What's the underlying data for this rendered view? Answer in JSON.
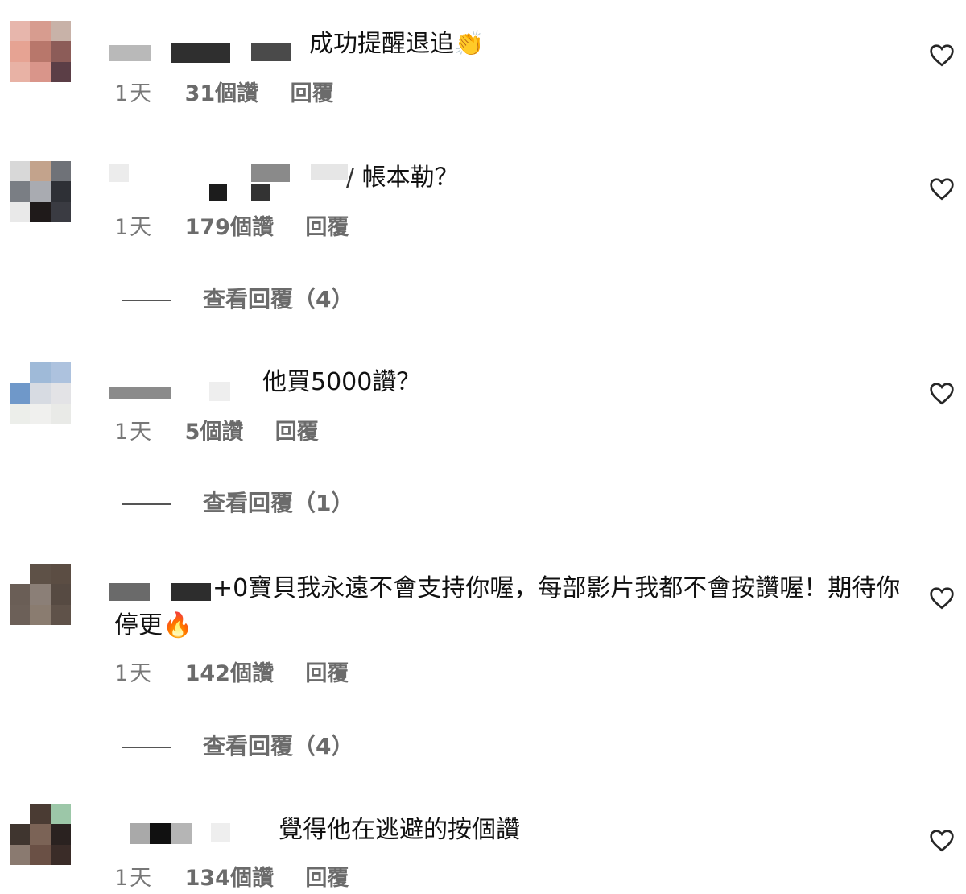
{
  "comments": [
    {
      "text": "成功提醒退追",
      "emoji": "👏",
      "time": "1天",
      "likes": "31個讚",
      "reply": "回覆",
      "view_replies": null,
      "avatar_colors": [
        "#e7b6ac",
        "#d79c8f",
        "#c8b2a8",
        "#e6a393",
        "#b8776b",
        "#8c5c58",
        "#e8b2a5",
        "#d9958a",
        "#5b3e46"
      ]
    },
    {
      "text": "帳本勒？",
      "emoji": "",
      "time": "1天",
      "likes": "179個讚",
      "reply": "回覆",
      "view_replies": "查看回覆（4）",
      "avatar_colors": [
        "#d8d8d8",
        "#c3a38c",
        "#6f7278",
        "#7a7e84",
        "#a9abb1",
        "#2e3036",
        "#e9e9e9",
        "#1f1a1a",
        "#3a3b42"
      ]
    },
    {
      "text": "他買5000讚？",
      "emoji": "",
      "time": "1天",
      "likes": "5個讚",
      "reply": "回覆",
      "view_replies": "查看回覆（1）",
      "avatar_colors": [
        "#ffffff",
        "#9fbad8",
        "#adc2de",
        "#6f98c9",
        "#d7dbe2",
        "#e3e3e6",
        "#eceeea",
        "#f0f0ee",
        "#e9eae7"
      ]
    },
    {
      "text": "+0寶貝我永遠不會支持你喔，每部影片我都不會按讚喔！期待你停更",
      "emoji": "🔥",
      "time": "1天",
      "likes": "142個讚",
      "reply": "回覆",
      "view_replies": "查看回覆（4）",
      "avatar_colors": [
        "#ffffff",
        "#5e5147",
        "#5b4d43",
        "#6a5e56",
        "#8b7f77",
        "#564a42",
        "#6c6058",
        "#8a7c70",
        "#5f5249"
      ]
    },
    {
      "text": "覺得他在逃避的按個讚",
      "emoji": "",
      "time": "1天",
      "likes": "134個讚",
      "reply": "回覆",
      "view_replies": null,
      "avatar_colors": [
        "#ffffff",
        "#4a3b33",
        "#9cc7a8",
        "#3f352f",
        "#7b6356",
        "#2a2220",
        "#8a7a70",
        "#6a5045",
        "#3a2c28"
      ]
    }
  ],
  "icons": {
    "like": "heart-outline-icon"
  }
}
